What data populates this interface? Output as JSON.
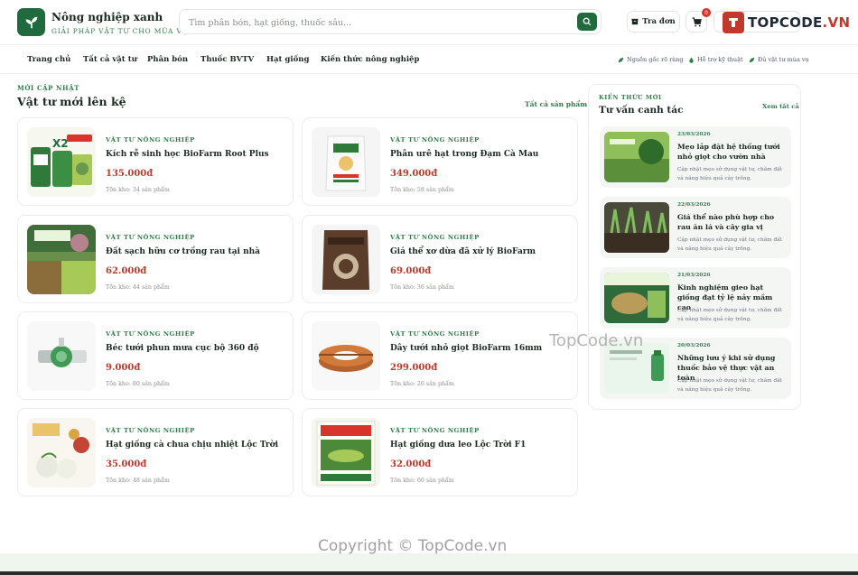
{
  "brand": {
    "name": "Nông nghiệp xanh",
    "tagline": "GIẢI PHÁP VẬT TƯ CHO MÙA VỤ"
  },
  "search": {
    "placeholder": "Tìm phân bón, hạt giống, thuốc sâu..."
  },
  "header": {
    "track_label": "Tra đơn",
    "cart_count": "0"
  },
  "watermark": {
    "logo_text": "TOPCODE",
    "logo_suffix": ".VN",
    "center_text": "TopCode.vn",
    "copyright": "Copyright © TopCode.vn"
  },
  "nav": {
    "items": [
      "Trang chủ",
      "Tất cả vật tư",
      "Phân bón",
      "Thuốc BVTV",
      "Hạt giống",
      "Kiến thức nông nghiệp"
    ],
    "utilities": [
      "Nguồn gốc rõ ràng",
      "Hỗ trợ kỹ thuật",
      "Đủ vật tư mùa vụ"
    ]
  },
  "products_section": {
    "eyebrow": "MỚI CẬP NHẬT",
    "title": "Vật tư mới lên kệ",
    "see_all": "Tất cả sản phẩm",
    "items": [
      {
        "category": "VẬT TƯ NÔNG NGHIỆP",
        "name": "Kích rễ sinh học BioFarm Root Plus",
        "price": "135.000đ",
        "stock": "Tồn kho: 34 sản phẩm"
      },
      {
        "category": "VẬT TƯ NÔNG NGHIỆP",
        "name": "Phân urê hạt trong Đạm Cà Mau",
        "price": "349.000đ",
        "stock": "Tồn kho: 58 sản phẩm"
      },
      {
        "category": "VẬT TƯ NÔNG NGHIỆP",
        "name": "Đất sạch hữu cơ trồng rau tại nhà",
        "price": "62.000đ",
        "stock": "Tồn kho: 44 sản phẩm"
      },
      {
        "category": "VẬT TƯ NÔNG NGHIỆP",
        "name": "Giá thể xơ dừa đã xử lý BioFarm",
        "price": "69.000đ",
        "stock": "Tồn kho: 36 sản phẩm"
      },
      {
        "category": "VẬT TƯ NÔNG NGHIỆP",
        "name": "Béc tưới phun mưa cục bộ 360 độ",
        "price": "9.000đ",
        "stock": "Tồn kho: 80 sản phẩm"
      },
      {
        "category": "VẬT TƯ NÔNG NGHIỆP",
        "name": "Dây tưới nhỏ giọt BioFarm 16mm",
        "price": "299.000đ",
        "stock": "Tồn kho: 26 sản phẩm"
      },
      {
        "category": "VẬT TƯ NÔNG NGHIỆP",
        "name": "Hạt giống cà chua chịu nhiệt Lộc Trời",
        "price": "35.000đ",
        "stock": "Tồn kho: 48 sản phẩm"
      },
      {
        "category": "VẬT TƯ NÔNG NGHIỆP",
        "name": "Hạt giống dưa leo Lộc Trời F1",
        "price": "32.000đ",
        "stock": "Tồn kho: 60 sản phẩm"
      }
    ]
  },
  "articles_section": {
    "eyebrow": "KIẾN THỨC MỚI",
    "title": "Tư vấn canh tác",
    "see_all": "Xem tất cả",
    "items": [
      {
        "date": "23/03/2026",
        "title": "Mẹo lắp đặt hệ thống tưới nhỏ giọt cho vườn nhà",
        "desc": "Cập nhật mẹo sử dụng vật tư, chăm đất và nâng hiệu quả cây trồng."
      },
      {
        "date": "22/03/2026",
        "title": "Giá thể nào phù hợp cho rau ăn lá và cây gia vị",
        "desc": "Cập nhật mẹo sử dụng vật tư, chăm đất và nâng hiệu quả cây trồng."
      },
      {
        "date": "21/03/2026",
        "title": "Kinh nghiệm gieo hạt giống đạt tỷ lệ nảy mầm cao",
        "desc": "Cập nhật mẹo sử dụng vật tư, chăm đất và nâng hiệu quả cây trồng."
      },
      {
        "date": "20/03/2026",
        "title": "Những lưu ý khi sử dụng thuốc bảo vệ thực vật an toàn",
        "desc": "Cập nhật mẹo sử dụng vật tư, chăm đất và nâng hiệu quả cây trồng."
      }
    ]
  },
  "colors": {
    "brand_green": "#1f6b3d",
    "accent_green": "#2e7d4a",
    "price_red": "#c0392b"
  }
}
